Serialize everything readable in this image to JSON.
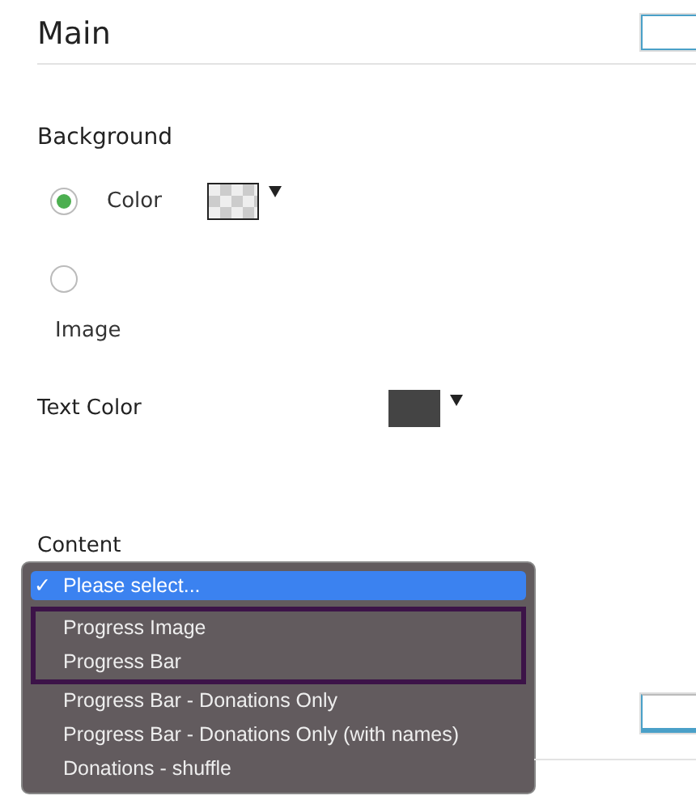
{
  "header": {
    "title": "Main"
  },
  "background": {
    "label": "Background",
    "options": [
      {
        "label": "Color",
        "selected": true
      },
      {
        "label": "Image",
        "selected": false
      }
    ]
  },
  "text_color": {
    "label": "Text Color",
    "color": "#444444"
  },
  "content": {
    "label": "Content",
    "check": "✓",
    "options": [
      {
        "label": "Please select...",
        "selected": true,
        "highlighted": false
      },
      {
        "label": "Progress Image",
        "selected": false,
        "highlighted": true
      },
      {
        "label": "Progress Bar",
        "selected": false,
        "highlighted": true
      },
      {
        "label": "Progress Bar - Donations Only",
        "selected": false,
        "highlighted": false
      },
      {
        "label": "Progress Bar - Donations Only (with names)",
        "selected": false,
        "highlighted": false
      },
      {
        "label": "Donations - shuffle",
        "selected": false,
        "highlighted": false
      }
    ]
  }
}
